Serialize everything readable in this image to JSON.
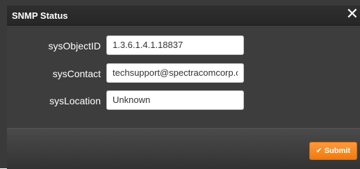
{
  "dialog": {
    "title": "SNMP Status",
    "close_glyph": "✕"
  },
  "fields": [
    {
      "label": "sysObjectID",
      "value": "1.3.6.1.4.1.18837"
    },
    {
      "label": "sysContact",
      "value": "techsupport@spectracomcorp.com"
    },
    {
      "label": "sysLocation",
      "value": "Unknown"
    }
  ],
  "footer": {
    "submit_label": "Submit",
    "submit_icon": "checkmark-icon",
    "accent_color": "#f58a1f"
  }
}
